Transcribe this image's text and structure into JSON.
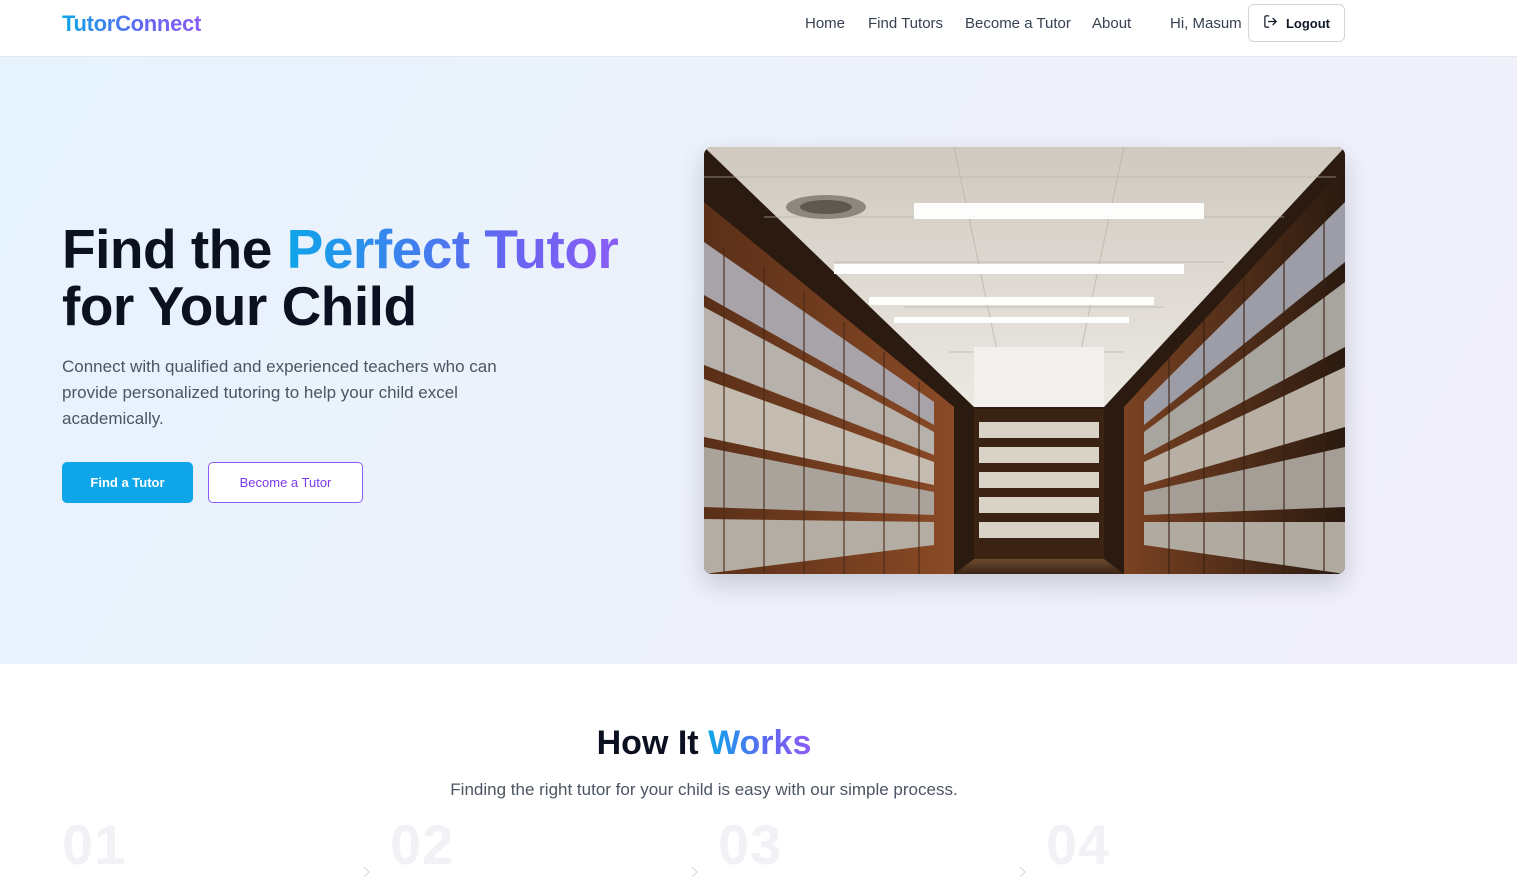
{
  "header": {
    "logo": "TutorConnect",
    "nav": [
      "Home",
      "Find Tutors",
      "Become a Tutor",
      "About"
    ],
    "greeting": "Hi, Masum",
    "logout_label": "Logout"
  },
  "hero": {
    "title_part1": "Find the ",
    "title_highlight": "Perfect Tutor",
    "title_part2": "for Your Child",
    "description": "Connect with qualified and experienced teachers who can provide personalized tutoring to help your child excel academically.",
    "primary_button": "Find a Tutor",
    "secondary_button": "Become a Tutor",
    "image_icon": "library-bookshelves-photo"
  },
  "how_it_works": {
    "title_part1": "How It ",
    "title_highlight": "Works",
    "subtitle": "Finding the right tutor for your child is easy with our simple process.",
    "steps": [
      "01",
      "02",
      "03",
      "04"
    ]
  },
  "colors": {
    "accent_blue": "#0ea5e9",
    "accent_purple": "#8b5cf6",
    "text_dark": "#0b1120"
  }
}
